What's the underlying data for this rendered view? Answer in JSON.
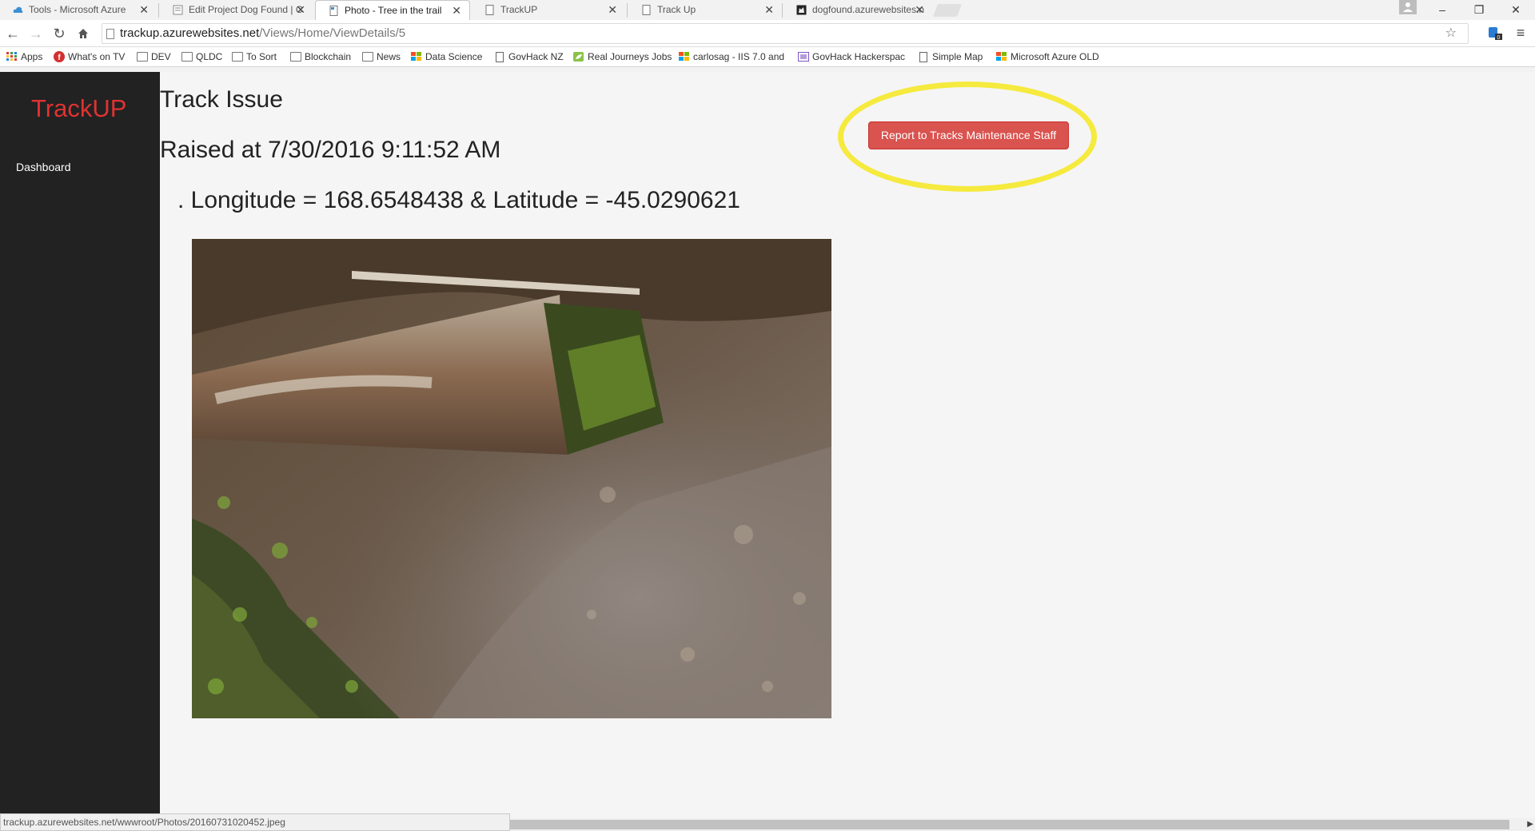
{
  "browser": {
    "tabs": [
      {
        "title": "Tools - Microsoft Azure",
        "active": false
      },
      {
        "title": "Edit Project Dog Found | C",
        "active": false
      },
      {
        "title": "Photo - Tree in the trail",
        "active": true
      },
      {
        "title": "TrackUP",
        "active": false
      },
      {
        "title": "Track Up",
        "active": false
      },
      {
        "title": "dogfound.azurewebsites.n",
        "active": false
      }
    ],
    "url_host": "trackup.azurewebsites.net",
    "url_path": "/Views/Home/ViewDetails/5",
    "extension_badge": "0",
    "bookmarks": [
      {
        "label": "Apps",
        "icon": "apps-grid-icon"
      },
      {
        "label": "What's on TV",
        "icon": "red-f-icon"
      },
      {
        "label": "DEV",
        "icon": "folder-icon"
      },
      {
        "label": "QLDC",
        "icon": "folder-icon"
      },
      {
        "label": "To Sort",
        "icon": "folder-icon"
      },
      {
        "label": "Blockchain",
        "icon": "folder-icon"
      },
      {
        "label": "News",
        "icon": "folder-icon"
      },
      {
        "label": "Data Science",
        "icon": "windows-logo-icon"
      },
      {
        "label": "GovHack NZ",
        "icon": "page-icon"
      },
      {
        "label": "Real Journeys Jobs",
        "icon": "leaf-icon"
      },
      {
        "label": "carlosag - IIS 7.0 and",
        "icon": "windows-logo-icon"
      },
      {
        "label": "GovHack Hackerspac",
        "icon": "govhack-icon"
      },
      {
        "label": "Simple Map",
        "icon": "page-icon"
      },
      {
        "label": "Microsoft Azure OLD",
        "icon": "windows-logo-icon"
      }
    ],
    "status_text": "trackup.azurewebsites.net/wwwroot/Photos/20160731020452.jpeg"
  },
  "app": {
    "brand": "TrackUP",
    "nav": [
      {
        "label": "Dashboard"
      }
    ],
    "title": "Track Issue",
    "raised": "Raised at 7/30/2016 9:11:52 AM",
    "coords": ". Longitude = 168.6548438 & Latitude = -45.0290621",
    "report_button": "Report to Tracks Maintenance Staff"
  },
  "colors": {
    "brand_red": "#e03232",
    "button_red": "#d9534f",
    "sidebar_bg": "#222222",
    "highlight_yellow": "#f5ea3d"
  }
}
